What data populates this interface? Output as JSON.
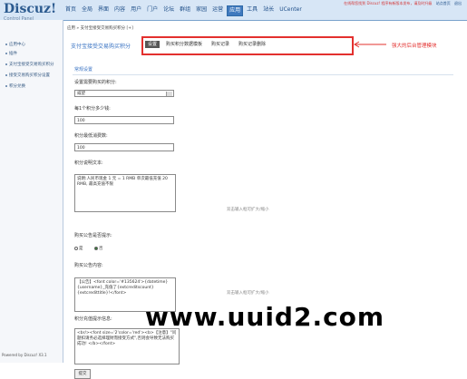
{
  "header": {
    "logo_main": "Discuz!",
    "logo_sub": "Control Panel",
    "nav": [
      "首页",
      "全局",
      "界面",
      "内容",
      "用户",
      "门户",
      "论坛",
      "群组",
      "家园",
      "运营",
      "应用",
      "工具",
      "站长",
      "UCenter"
    ],
    "active_nav": "应用",
    "notice": "在线帮您找到 Discuz! 程序有新版本发布，请及时升级",
    "links": [
      "站点首页",
      "退出"
    ]
  },
  "sidebar": {
    "items": [
      "应用中心",
      "插件",
      "支付宝接受交易购买积分",
      "接受交易购买积分设置",
      "积分兑换"
    ],
    "powered": "Powered by Discuz! X3.1"
  },
  "main": {
    "breadcrumb": "应用 » 支付宝接受交易购买积分 [+]",
    "plugin_title": "支付宝接受交易购买积分",
    "tabs": [
      "设置",
      "购买积分数据模板",
      "购买记录",
      "购买记录删除"
    ],
    "annotation": "强大的后台管理模块",
    "section_title": "常规设置",
    "fields": {
      "credit_type_label": "设置需要购买的积分:",
      "credit_type_value": "威望",
      "price_label": "每1个积分多少钱:",
      "price_value": "100",
      "min_label": "积分最低消费数:",
      "min_value": "100",
      "desc_label": "积分说明文本:",
      "desc_value": "说明:人民币现金 1 元 = 1 RMB 单次最低充值 20 RMB, 最高充值不限",
      "desc_hint": "双击输入框可扩大/缩小",
      "notice_label": "购买公告是否提示:",
      "notice_options": [
        "是",
        "否"
      ],
      "content_label": "购买公告内容:",
      "content_value": "【公告】<font color='#135624'>{datetime} {username}_充值了{extcreditscount}{extcredittitle}!</font>",
      "content_hint": "双击输入框可扩大/缩小",
      "over_label": "积分充值提示信息:",
      "over_value": "<br/><font size='2'color='red'><b>【注意】\"问题扣请务必选择理财而接受方式\",否则会导致无法购买成功! </b></font>",
      "submit": "提交"
    }
  },
  "watermark": "www.uuid2.com",
  "colors": {
    "accent": "#3f79be",
    "highlight": "#e3302e"
  }
}
